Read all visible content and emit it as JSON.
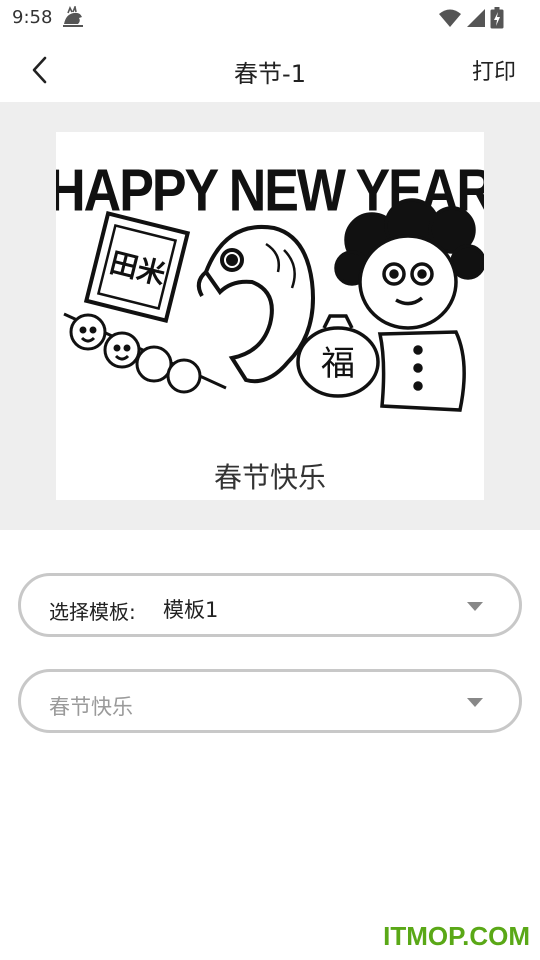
{
  "status_bar": {
    "time": "9:58",
    "icons": [
      "notification-bird-icon",
      "wifi-icon",
      "signal-icon",
      "battery-icon"
    ]
  },
  "app_bar": {
    "title": "春节-1",
    "print_label": "打印",
    "back_icon": "chevron-left-icon"
  },
  "preview": {
    "headline": "HAPPY NEW YEAR",
    "frame_text": "田米",
    "bag_text": "福",
    "caption": "春节快乐"
  },
  "template_selector": {
    "label": "选择模板:",
    "value": "模板1"
  },
  "text_selector": {
    "placeholder": "春节快乐"
  },
  "watermark": "ITMOP.COM",
  "colors": {
    "preview_bg": "#eeeeee",
    "border": "#c8c8c8",
    "placeholder": "#9a9a9a",
    "watermark": "#5aa817"
  }
}
